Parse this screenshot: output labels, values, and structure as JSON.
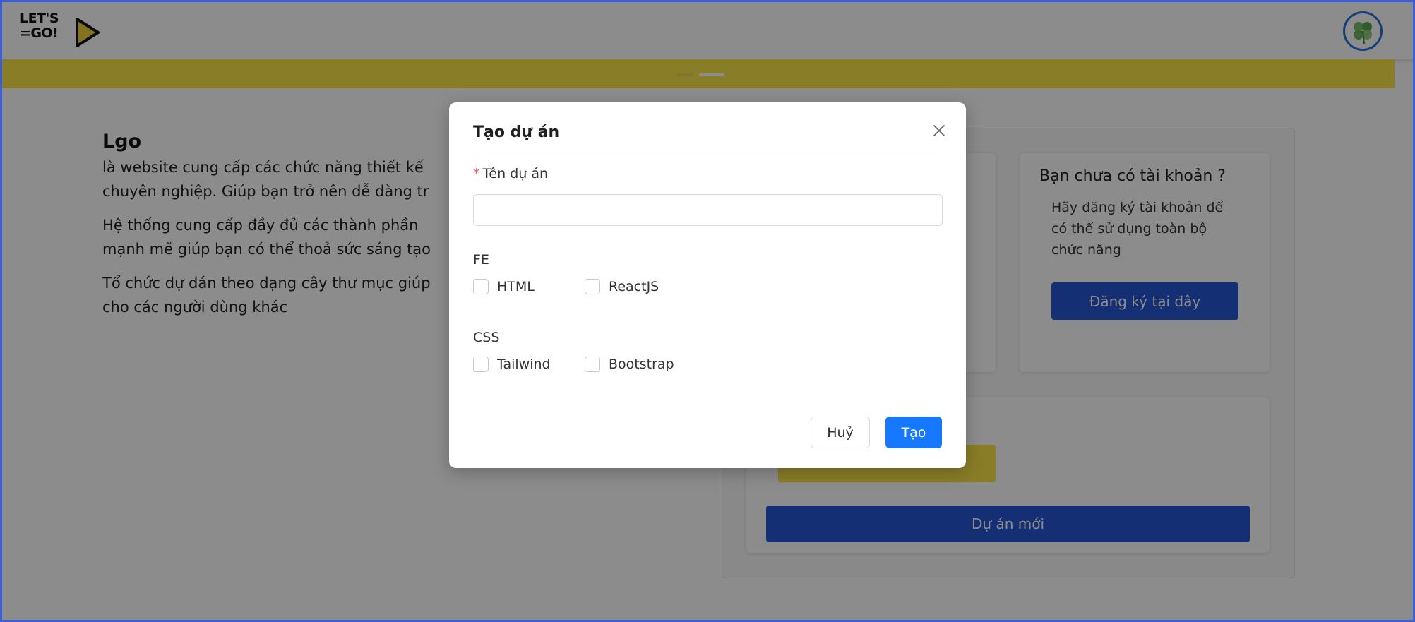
{
  "header": {
    "logo_line1": "LET'S",
    "logo_line2": "=GO!",
    "avatar_icon": "clover-avatar-icon"
  },
  "intro": {
    "title": "Lgo",
    "para1": "là website cung cấp các chức năng thiết kế ... chuyên nghiệp. Giúp bạn trở nên dễ dàng tr...",
    "para1_line1": "là website cung cấp các chức năng thiết kế",
    "para1_line2": "chuyên nghiệp. Giúp bạn trở nên dễ dàng tr",
    "para2_line1": "Hệ thống cung cấp đầy đủ các thành phần",
    "para2_line2": "mạnh mẽ giúp bạn có thể thoả sức sáng tạo",
    "para3_line1": "Tổ chức dự dán theo dạng cây thư mục giúp",
    "para3_line2": "cho các người dùng khác"
  },
  "signup_card": {
    "title": "Bạn chưa có tài khoản ?",
    "text": "Hãy đăng ký tài khoản để có thể sử dụng toàn bộ chức năng",
    "button": "Đăng ký tại đây"
  },
  "bottom_card": {
    "new_project_button": "Dự án mới"
  },
  "modal": {
    "title": "Tạo dự án",
    "name_label": "Tên dự án",
    "required_mark": "*",
    "name_value": "",
    "groups": [
      {
        "label": "FE",
        "options": [
          {
            "label": "HTML",
            "checked": false
          },
          {
            "label": "ReactJS",
            "checked": false
          }
        ]
      },
      {
        "label": "CSS",
        "options": [
          {
            "label": "Tailwind",
            "checked": false
          },
          {
            "label": "Bootstrap",
            "checked": false
          }
        ]
      }
    ],
    "cancel_label": "Huỷ",
    "create_label": "Tạo"
  },
  "colors": {
    "primary_blue": "#2756d4",
    "accent_yellow": "#fbe44a",
    "modal_primary": "#1677ff",
    "required_red": "#ff4d4f"
  }
}
